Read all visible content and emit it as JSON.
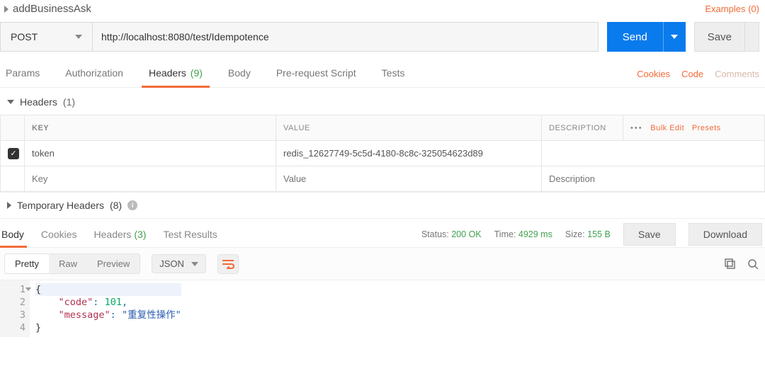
{
  "title": "addBusinessAsk",
  "examples": {
    "label": "Examples",
    "count": 0
  },
  "request": {
    "method": "POST",
    "url": "http://localhost:8080/test/Idempotence",
    "send_label": "Send",
    "save_label": "Save"
  },
  "req_tabs": {
    "params": "Params",
    "authorization": "Authorization",
    "headers": {
      "label": "Headers",
      "count": 9
    },
    "body": "Body",
    "prerequest": "Pre-request Script",
    "tests": "Tests"
  },
  "right_links": {
    "cookies": "Cookies",
    "code": "Code",
    "comments": "Comments"
  },
  "headers_section": {
    "label": "Headers",
    "count": 1
  },
  "headers_cols": {
    "key": "KEY",
    "value": "VALUE",
    "description": "DESCRIPTION"
  },
  "headers_actions": {
    "bulk": "Bulk Edit",
    "presets": "Presets"
  },
  "headers_rows": [
    {
      "checked": true,
      "key": "token",
      "value": "redis_12627749-5c5d-4180-8c8c-325054623d89",
      "description": ""
    }
  ],
  "headers_placeholders": {
    "key": "Key",
    "value": "Value",
    "description": "Description"
  },
  "temp_headers": {
    "label": "Temporary Headers",
    "count": 8
  },
  "response": {
    "tabs": {
      "body": "Body",
      "cookies": "Cookies",
      "headers": {
        "label": "Headers",
        "count": 3
      },
      "tests": "Test Results"
    },
    "status": {
      "label": "Status:",
      "value": "200 OK"
    },
    "time": {
      "label": "Time:",
      "value": "4929 ms"
    },
    "size": {
      "label": "Size:",
      "value": "155 B"
    },
    "save_label": "Save",
    "download_label": "Download"
  },
  "body_view": {
    "views": {
      "pretty": "Pretty",
      "raw": "Raw",
      "preview": "Preview"
    },
    "format": "JSON"
  },
  "body_json": {
    "l1": "{",
    "l2_key": "\"code\"",
    "l2_sep": ": ",
    "l2_val": "101",
    "l2_comma": ",",
    "l3_key": "\"message\"",
    "l3_sep": ": ",
    "l3_val": "\"重复性操作\"",
    "l4": "}",
    "ln1": "1",
    "ln2": "2",
    "ln3": "3",
    "ln4": "4"
  }
}
